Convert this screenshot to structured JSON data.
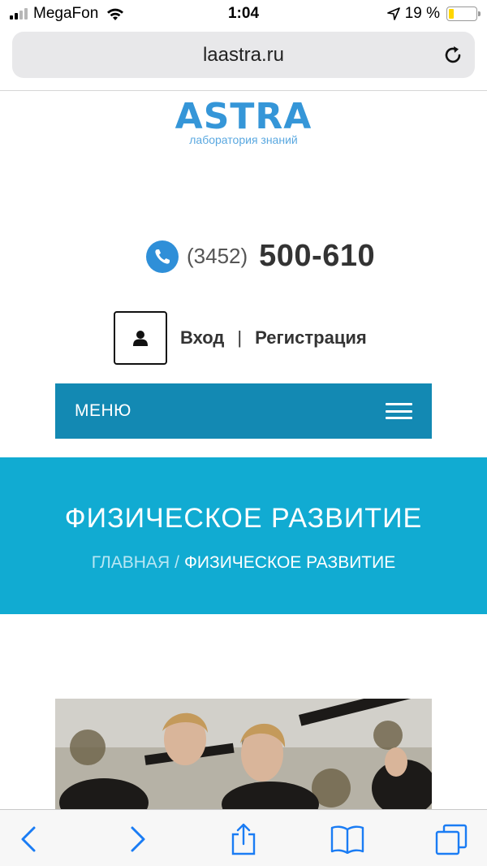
{
  "status_bar": {
    "carrier": "MegaFon",
    "time": "1:04",
    "battery": "19 %",
    "battery_level": 0.19,
    "icons": [
      "signal-icon",
      "wifi-icon",
      "location-arrow-icon",
      "battery-icon"
    ]
  },
  "browser": {
    "url": "laastra.ru",
    "toolbar_icons": [
      "back-icon",
      "forward-icon",
      "share-icon",
      "bookmarks-icon",
      "tabs-icon"
    ]
  },
  "site": {
    "logo_text": "ASTRA",
    "logo_tagline": "лаборатория знаний",
    "phone_code": "(3452)",
    "phone_number": "500-610",
    "login": "Вход",
    "separator": "|",
    "register": "Регистрация",
    "menu_label": "МЕНЮ",
    "page_title": "ФИЗИЧЕСКОЕ РАЗВИТИЕ",
    "breadcrumb_home": "ГЛАВНАЯ",
    "breadcrumb_sep": "/",
    "breadcrumb_current": "ФИЗИЧЕСКОЕ РАЗВИТИЕ"
  },
  "colors": {
    "brand_blue": "#3596d8",
    "menu_bg": "#1389b3",
    "banner_bg": "#11abd2"
  }
}
